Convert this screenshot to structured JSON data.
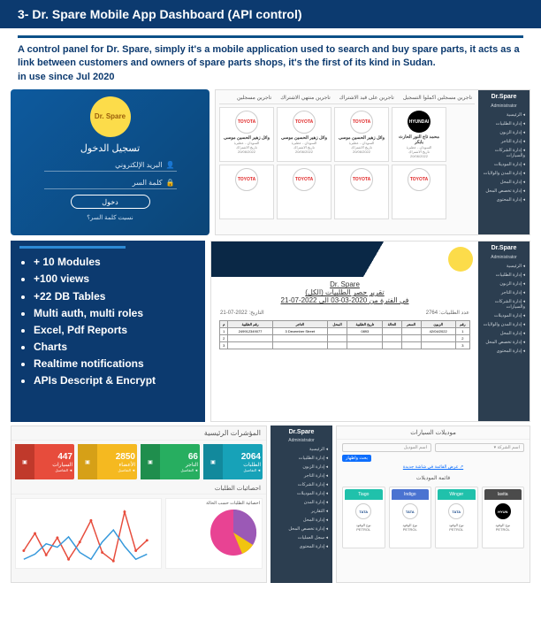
{
  "page": {
    "title": "3- Dr. Spare Mobile App Dashboard (API control)",
    "description": "A control panel for Dr. Spare, simply it's a mobile application used to search and buy spare parts, it acts as a link between customers and owners of spare parts shops, it's the first of its kind in Sudan.",
    "since": " in use since Jul 2020"
  },
  "login": {
    "logo_text": "Dr. Spare",
    "title": "تسجيل الدخول",
    "email_label": "البريد الإلكتروني",
    "password_label": "كلمة السر",
    "button": "دخول",
    "forgot": "نسيت كلمة السر؟"
  },
  "sidebar": {
    "brand": "Dr.Spare",
    "admin": "Administrator",
    "items": [
      {
        "label": "الرئيسية"
      },
      {
        "label": "إدارة الطلبيات"
      },
      {
        "label": "إدارة الزبون"
      },
      {
        "label": "إدارة التاجر"
      },
      {
        "label": "إدارة الشركات والسيارات"
      },
      {
        "label": "إدارة الموديلات"
      },
      {
        "label": "إدارة المدن والولايات"
      },
      {
        "label": "إدارة المحل"
      },
      {
        "label": "إدارة تخصص المحل"
      },
      {
        "label": "إدارة المحتوى"
      }
    ]
  },
  "tabs": {
    "items": [
      {
        "label": "تاجرين مسجلين اكملوا التسجيل"
      },
      {
        "label": "تاجرين على قيد الاشتراك"
      },
      {
        "label": "تاجرين منتهي الاشتراك"
      },
      {
        "label": "تاجرين مسجلين"
      }
    ]
  },
  "cards": [
    {
      "brand": "TOYOTA",
      "icon": "toyota",
      "name": "وائل زهير الحسين موسى",
      "sub": "السودان - عطبرة",
      "info": "تاريخ الاشتراك",
      "date": "20/06/2022"
    },
    {
      "brand": "TOYOTA",
      "icon": "toyota",
      "name": "وائل زهير الحسين موسى",
      "sub": "السودان - عطبرة",
      "info": "تاريخ الاشتراك",
      "date": "20/06/2022"
    },
    {
      "brand": "TOYOTA",
      "icon": "toyota",
      "name": "وائل زهير الحسين موسى",
      "sub": "السودان - عطبرة",
      "info": "تاريخ الاشتراك",
      "date": "20/06/2022"
    },
    {
      "brand": "HYUNDAI",
      "icon": "hyundai",
      "name": "محمد تاج النور الحارث بابكر",
      "sub": "السودان - عطبرة",
      "info": "تاريخ الاشتراك",
      "date": "20/06/2022"
    }
  ],
  "features": {
    "items": [
      "+ 10 Modules",
      "+100 views",
      "+22 DB Tables",
      "Multi auth, multi roles",
      "Excel, Pdf Reports",
      "Charts",
      "Realtime notifications",
      "APIs Descript & Encrypt"
    ]
  },
  "report": {
    "title1": "Dr. Spare",
    "title2": "تقرير حصر الطلبيات (الكل)",
    "title3": "في الفترة من 2020-03-03 الى 2022-07-21",
    "meta_left": "التاريخ: 2022-07-21",
    "meta_right": "عدد الطلبيات: 2764",
    "headers": [
      "م",
      "رقم الطلبية",
      "التاجر",
      "المحل",
      "تاريخ الطلبية",
      "الحالة",
      "السعر",
      "الزبون",
      "رقم"
    ],
    "rows": [
      [
        "1",
        "249912349077",
        "3 December Street",
        "",
        "0893",
        "",
        "",
        "42/04/2022",
        "1"
      ],
      [
        "2",
        "",
        "",
        "",
        "",
        "",
        "",
        "",
        "2"
      ],
      [
        "3",
        "",
        "",
        "",
        "",
        "",
        "",
        "",
        "3"
      ]
    ]
  },
  "stats": {
    "title": "المؤشرات الرئيسية",
    "subtitle": "احصائيات الطلبات",
    "cards": [
      {
        "num": "447",
        "label": "السيارات",
        "detail": "التفاصيل ◄",
        "color": "red"
      },
      {
        "num": "2850",
        "label": "الأعضاء",
        "detail": "التفاصيل ◄",
        "color": "yellow"
      },
      {
        "num": "66",
        "label": "التاجر",
        "detail": "التفاصيل ◄",
        "color": "green"
      },
      {
        "num": "2064",
        "label": "الطلبات",
        "detail": "التفاصيل ◄",
        "color": "cyan"
      }
    ],
    "pie_title": "احصائية الطلبات حسب الحالة"
  },
  "chart_data": {
    "type": "line",
    "series": [
      {
        "name": "series1",
        "color": "#e74c3c",
        "values": [
          4,
          7,
          3,
          6,
          2,
          5,
          8,
          3,
          1,
          9,
          3,
          5
        ]
      },
      {
        "name": "series2",
        "color": "#3498db",
        "values": [
          2,
          3,
          5,
          4,
          6,
          3,
          2,
          5,
          7,
          4,
          2,
          3
        ]
      }
    ],
    "pie": {
      "type": "pie",
      "values": [
        55,
        30,
        15
      ],
      "colors": [
        "#e84393",
        "#9b59b6",
        "#f1c40f"
      ]
    }
  },
  "admin_nav": {
    "brand": "Dr.Spare",
    "admin": "Administrator",
    "items": [
      {
        "label": "الرئيسية"
      },
      {
        "label": "إدارة الطلبيات"
      },
      {
        "label": "إدارة الزبون"
      },
      {
        "label": "إدارة التاجر"
      },
      {
        "label": "إدارة الشركات"
      },
      {
        "label": "إدارة الموديلات"
      },
      {
        "label": "إدارة المدن"
      },
      {
        "label": "التقارير"
      },
      {
        "label": "إدارة المحل"
      },
      {
        "label": "إدارة تخصص المحل"
      },
      {
        "label": "سجل العمليات"
      },
      {
        "label": "إدارة المحتوى"
      }
    ]
  },
  "models": {
    "title": "موديلات السيارات",
    "search_label": "اسم الموديل",
    "brand_label": "اسم الشركة ▾",
    "search_btn": "بحث واظهار",
    "link": "عرض القائمة في شاشة جديدة ↗",
    "list_title": "قائمة الموديلات",
    "fuel_label": "نوع الوقود",
    "fuel": "PETROL",
    "cards": [
      {
        "name": "Tiago",
        "brand": "TATA",
        "icon": "tata",
        "color": "teal"
      },
      {
        "name": "Indigo",
        "brand": "TATA",
        "icon": "tata",
        "color": "blue"
      },
      {
        "name": "Winger",
        "brand": "TATA",
        "icon": "tata",
        "color": "teal"
      },
      {
        "name": "lavita",
        "brand": "HYUNDAI",
        "icon": "hyun",
        "color": "blk"
      }
    ]
  }
}
